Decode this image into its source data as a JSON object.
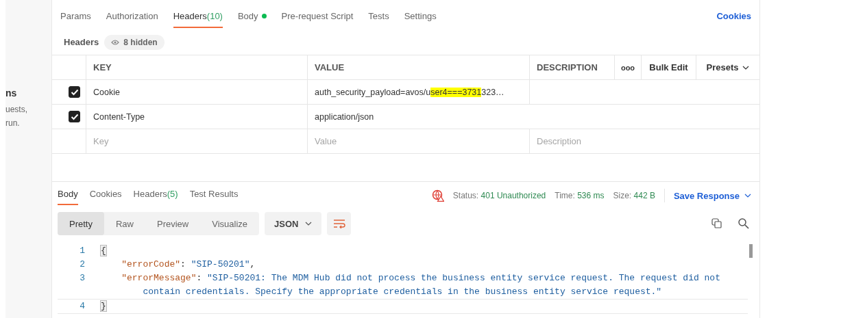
{
  "side_panel": {
    "texts": [
      "ns",
      "uests,",
      "run."
    ]
  },
  "request_tabs": [
    {
      "label": "Params",
      "selected": false
    },
    {
      "label": "Authorization",
      "selected": false
    },
    {
      "label": "Headers",
      "count": "(10)",
      "selected": true
    },
    {
      "label": "Body",
      "dot": true,
      "selected": false
    },
    {
      "label": "Pre-request Script",
      "selected": false
    },
    {
      "label": "Tests",
      "selected": false
    },
    {
      "label": "Settings",
      "selected": false
    }
  ],
  "cookies_link": "Cookies",
  "headers_bar": {
    "title": "Headers",
    "hidden_toggle": "8 hidden"
  },
  "headers_table": {
    "columns": [
      "KEY",
      "VALUE",
      "DESCRIPTION"
    ],
    "more": "ooo",
    "bulk_edit": "Bulk Edit",
    "presets": "Presets",
    "rows": [
      {
        "checked": true,
        "key": "Cookie",
        "value": [
          {
            "text": "auth_security_payload=avos/u",
            "highlighted": false
          },
          {
            "text": "ser4===3731",
            "highlighted": true
          },
          {
            "text": "323…",
            "highlighted": false
          }
        ]
      },
      {
        "checked": true,
        "key": "Content-Type",
        "value": [
          {
            "text": "application/json",
            "highlighted": false
          }
        ]
      }
    ],
    "new_row": [
      {
        "placeholder": "Key"
      },
      {
        "placeholder": "Value"
      },
      {
        "placeholder": "Description"
      }
    ]
  },
  "response_tabs": [
    {
      "label": "Body",
      "selected": true
    },
    {
      "label": "Cookies",
      "selected": false
    },
    {
      "label": "Headers",
      "count": "(5)",
      "selected": false
    },
    {
      "label": "Test Results",
      "selected": false
    }
  ],
  "status": [
    {
      "label": "Status:",
      "value": "401 Unauthorized"
    },
    {
      "label": "Time:",
      "value": "536 ms"
    },
    {
      "label": "Size:",
      "value": "442 B"
    }
  ],
  "save_response": "Save Response",
  "view_modes": [
    {
      "label": "Pretty",
      "selected": true
    },
    {
      "label": "Raw",
      "selected": false
    },
    {
      "label": "Preview",
      "selected": false
    },
    {
      "label": "Visualize",
      "selected": false
    }
  ],
  "format": "JSON",
  "code_lines": [
    {
      "number": "1",
      "rows": [
        [
          {
            "kind": "brace",
            "text": "{"
          }
        ]
      ]
    },
    {
      "number": "2",
      "rows": [
        [
          {
            "kind": "indent",
            "text": "    "
          },
          {
            "kind": "key",
            "text": "\"errorCode\""
          },
          {
            "kind": "punct",
            "text": ": "
          },
          {
            "kind": "string",
            "text": "\"SIP-50201\""
          },
          {
            "kind": "punct",
            "text": ","
          }
        ]
      ]
    },
    {
      "number": "3",
      "rows": [
        [
          {
            "kind": "indent",
            "text": "    "
          },
          {
            "kind": "key",
            "text": "\"errorMessage\""
          },
          {
            "kind": "punct",
            "text": ": "
          },
          {
            "kind": "string",
            "text": "\"SIP-50201: The MDM Hub did not process the business entity service request. The request did not"
          }
        ],
        [
          {
            "kind": "indent",
            "text": "        "
          },
          {
            "kind": "string",
            "text": "contain credentials. Specify the appropriate credentials in the business entity service request.\""
          }
        ]
      ]
    },
    {
      "number": "4",
      "rows": [
        [
          {
            "kind": "brace",
            "text": "}"
          }
        ]
      ]
    }
  ]
}
